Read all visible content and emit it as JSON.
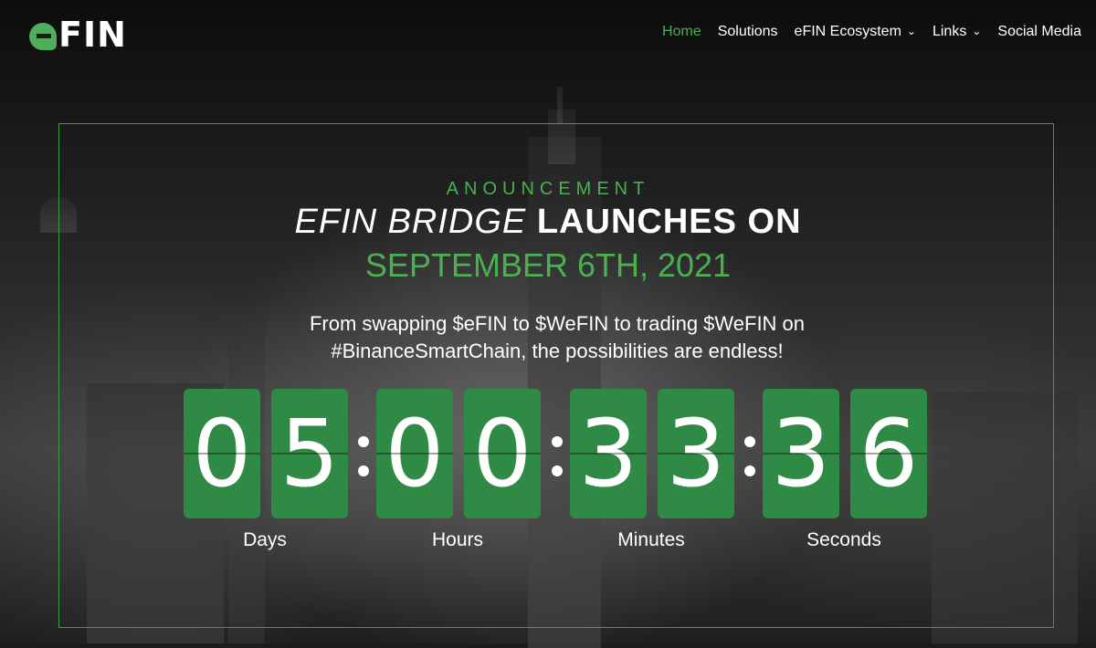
{
  "brand": {
    "logo_text": "FIN"
  },
  "nav": {
    "items": [
      {
        "label": "Home",
        "active": true,
        "has_menu": false
      },
      {
        "label": "Solutions",
        "active": false,
        "has_menu": false
      },
      {
        "label": "eFIN Ecosystem",
        "active": false,
        "has_menu": true
      },
      {
        "label": "Links",
        "active": false,
        "has_menu": true
      },
      {
        "label": "Social Media",
        "active": false,
        "has_menu": false
      }
    ]
  },
  "announcement": {
    "kicker": "ANOUNCEMENT",
    "headline_italic": "EFIN BRIDGE",
    "headline_rest": "LAUNCHES ON",
    "date": "SEPTEMBER 6TH, 2021",
    "subtitle_line1": "From swapping $eFIN to $WeFIN to trading $WeFIN on",
    "subtitle_line2": "#BinanceSmartChain, the possibilities are endless!"
  },
  "countdown": {
    "days": [
      "0",
      "5"
    ],
    "hours": [
      "0",
      "0"
    ],
    "minutes": [
      "3",
      "3"
    ],
    "seconds": [
      "3",
      "6"
    ],
    "labels": {
      "days": "Days",
      "hours": "Hours",
      "minutes": "Minutes",
      "seconds": "Seconds"
    }
  },
  "colors": {
    "accent": "#4caf50",
    "digit_bg": "#2f8a45",
    "frame": "#3a9f48"
  }
}
